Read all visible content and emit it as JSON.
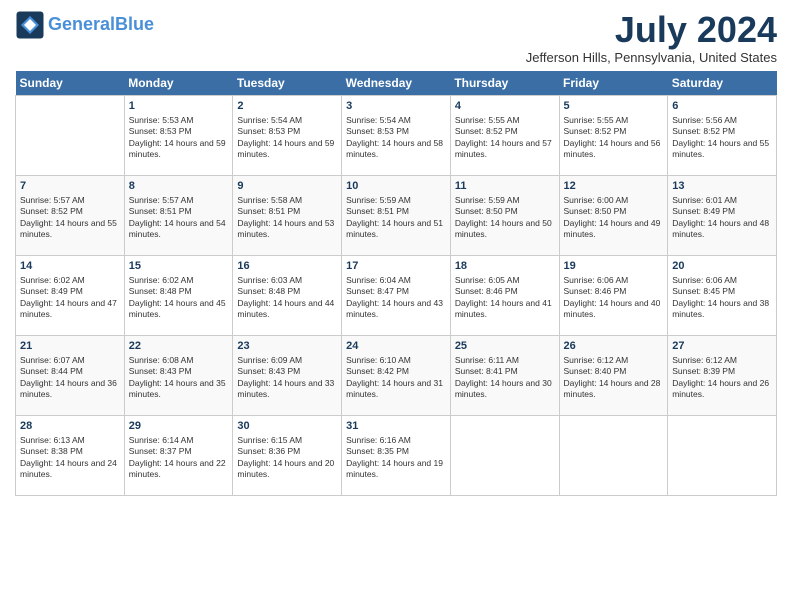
{
  "header": {
    "logo_line1": "General",
    "logo_line2": "Blue",
    "month_title": "July 2024",
    "location": "Jefferson Hills, Pennsylvania, United States"
  },
  "days_of_week": [
    "Sunday",
    "Monday",
    "Tuesday",
    "Wednesday",
    "Thursday",
    "Friday",
    "Saturday"
  ],
  "weeks": [
    [
      {
        "day": "",
        "sunrise": "",
        "sunset": "",
        "daylight": ""
      },
      {
        "day": "1",
        "sunrise": "Sunrise: 5:53 AM",
        "sunset": "Sunset: 8:53 PM",
        "daylight": "Daylight: 14 hours and 59 minutes."
      },
      {
        "day": "2",
        "sunrise": "Sunrise: 5:54 AM",
        "sunset": "Sunset: 8:53 PM",
        "daylight": "Daylight: 14 hours and 59 minutes."
      },
      {
        "day": "3",
        "sunrise": "Sunrise: 5:54 AM",
        "sunset": "Sunset: 8:53 PM",
        "daylight": "Daylight: 14 hours and 58 minutes."
      },
      {
        "day": "4",
        "sunrise": "Sunrise: 5:55 AM",
        "sunset": "Sunset: 8:52 PM",
        "daylight": "Daylight: 14 hours and 57 minutes."
      },
      {
        "day": "5",
        "sunrise": "Sunrise: 5:55 AM",
        "sunset": "Sunset: 8:52 PM",
        "daylight": "Daylight: 14 hours and 56 minutes."
      },
      {
        "day": "6",
        "sunrise": "Sunrise: 5:56 AM",
        "sunset": "Sunset: 8:52 PM",
        "daylight": "Daylight: 14 hours and 55 minutes."
      }
    ],
    [
      {
        "day": "7",
        "sunrise": "Sunrise: 5:57 AM",
        "sunset": "Sunset: 8:52 PM",
        "daylight": "Daylight: 14 hours and 55 minutes."
      },
      {
        "day": "8",
        "sunrise": "Sunrise: 5:57 AM",
        "sunset": "Sunset: 8:51 PM",
        "daylight": "Daylight: 14 hours and 54 minutes."
      },
      {
        "day": "9",
        "sunrise": "Sunrise: 5:58 AM",
        "sunset": "Sunset: 8:51 PM",
        "daylight": "Daylight: 14 hours and 53 minutes."
      },
      {
        "day": "10",
        "sunrise": "Sunrise: 5:59 AM",
        "sunset": "Sunset: 8:51 PM",
        "daylight": "Daylight: 14 hours and 51 minutes."
      },
      {
        "day": "11",
        "sunrise": "Sunrise: 5:59 AM",
        "sunset": "Sunset: 8:50 PM",
        "daylight": "Daylight: 14 hours and 50 minutes."
      },
      {
        "day": "12",
        "sunrise": "Sunrise: 6:00 AM",
        "sunset": "Sunset: 8:50 PM",
        "daylight": "Daylight: 14 hours and 49 minutes."
      },
      {
        "day": "13",
        "sunrise": "Sunrise: 6:01 AM",
        "sunset": "Sunset: 8:49 PM",
        "daylight": "Daylight: 14 hours and 48 minutes."
      }
    ],
    [
      {
        "day": "14",
        "sunrise": "Sunrise: 6:02 AM",
        "sunset": "Sunset: 8:49 PM",
        "daylight": "Daylight: 14 hours and 47 minutes."
      },
      {
        "day": "15",
        "sunrise": "Sunrise: 6:02 AM",
        "sunset": "Sunset: 8:48 PM",
        "daylight": "Daylight: 14 hours and 45 minutes."
      },
      {
        "day": "16",
        "sunrise": "Sunrise: 6:03 AM",
        "sunset": "Sunset: 8:48 PM",
        "daylight": "Daylight: 14 hours and 44 minutes."
      },
      {
        "day": "17",
        "sunrise": "Sunrise: 6:04 AM",
        "sunset": "Sunset: 8:47 PM",
        "daylight": "Daylight: 14 hours and 43 minutes."
      },
      {
        "day": "18",
        "sunrise": "Sunrise: 6:05 AM",
        "sunset": "Sunset: 8:46 PM",
        "daylight": "Daylight: 14 hours and 41 minutes."
      },
      {
        "day": "19",
        "sunrise": "Sunrise: 6:06 AM",
        "sunset": "Sunset: 8:46 PM",
        "daylight": "Daylight: 14 hours and 40 minutes."
      },
      {
        "day": "20",
        "sunrise": "Sunrise: 6:06 AM",
        "sunset": "Sunset: 8:45 PM",
        "daylight": "Daylight: 14 hours and 38 minutes."
      }
    ],
    [
      {
        "day": "21",
        "sunrise": "Sunrise: 6:07 AM",
        "sunset": "Sunset: 8:44 PM",
        "daylight": "Daylight: 14 hours and 36 minutes."
      },
      {
        "day": "22",
        "sunrise": "Sunrise: 6:08 AM",
        "sunset": "Sunset: 8:43 PM",
        "daylight": "Daylight: 14 hours and 35 minutes."
      },
      {
        "day": "23",
        "sunrise": "Sunrise: 6:09 AM",
        "sunset": "Sunset: 8:43 PM",
        "daylight": "Daylight: 14 hours and 33 minutes."
      },
      {
        "day": "24",
        "sunrise": "Sunrise: 6:10 AM",
        "sunset": "Sunset: 8:42 PM",
        "daylight": "Daylight: 14 hours and 31 minutes."
      },
      {
        "day": "25",
        "sunrise": "Sunrise: 6:11 AM",
        "sunset": "Sunset: 8:41 PM",
        "daylight": "Daylight: 14 hours and 30 minutes."
      },
      {
        "day": "26",
        "sunrise": "Sunrise: 6:12 AM",
        "sunset": "Sunset: 8:40 PM",
        "daylight": "Daylight: 14 hours and 28 minutes."
      },
      {
        "day": "27",
        "sunrise": "Sunrise: 6:12 AM",
        "sunset": "Sunset: 8:39 PM",
        "daylight": "Daylight: 14 hours and 26 minutes."
      }
    ],
    [
      {
        "day": "28",
        "sunrise": "Sunrise: 6:13 AM",
        "sunset": "Sunset: 8:38 PM",
        "daylight": "Daylight: 14 hours and 24 minutes."
      },
      {
        "day": "29",
        "sunrise": "Sunrise: 6:14 AM",
        "sunset": "Sunset: 8:37 PM",
        "daylight": "Daylight: 14 hours and 22 minutes."
      },
      {
        "day": "30",
        "sunrise": "Sunrise: 6:15 AM",
        "sunset": "Sunset: 8:36 PM",
        "daylight": "Daylight: 14 hours and 20 minutes."
      },
      {
        "day": "31",
        "sunrise": "Sunrise: 6:16 AM",
        "sunset": "Sunset: 8:35 PM",
        "daylight": "Daylight: 14 hours and 19 minutes."
      },
      {
        "day": "",
        "sunrise": "",
        "sunset": "",
        "daylight": ""
      },
      {
        "day": "",
        "sunrise": "",
        "sunset": "",
        "daylight": ""
      },
      {
        "day": "",
        "sunrise": "",
        "sunset": "",
        "daylight": ""
      }
    ]
  ]
}
